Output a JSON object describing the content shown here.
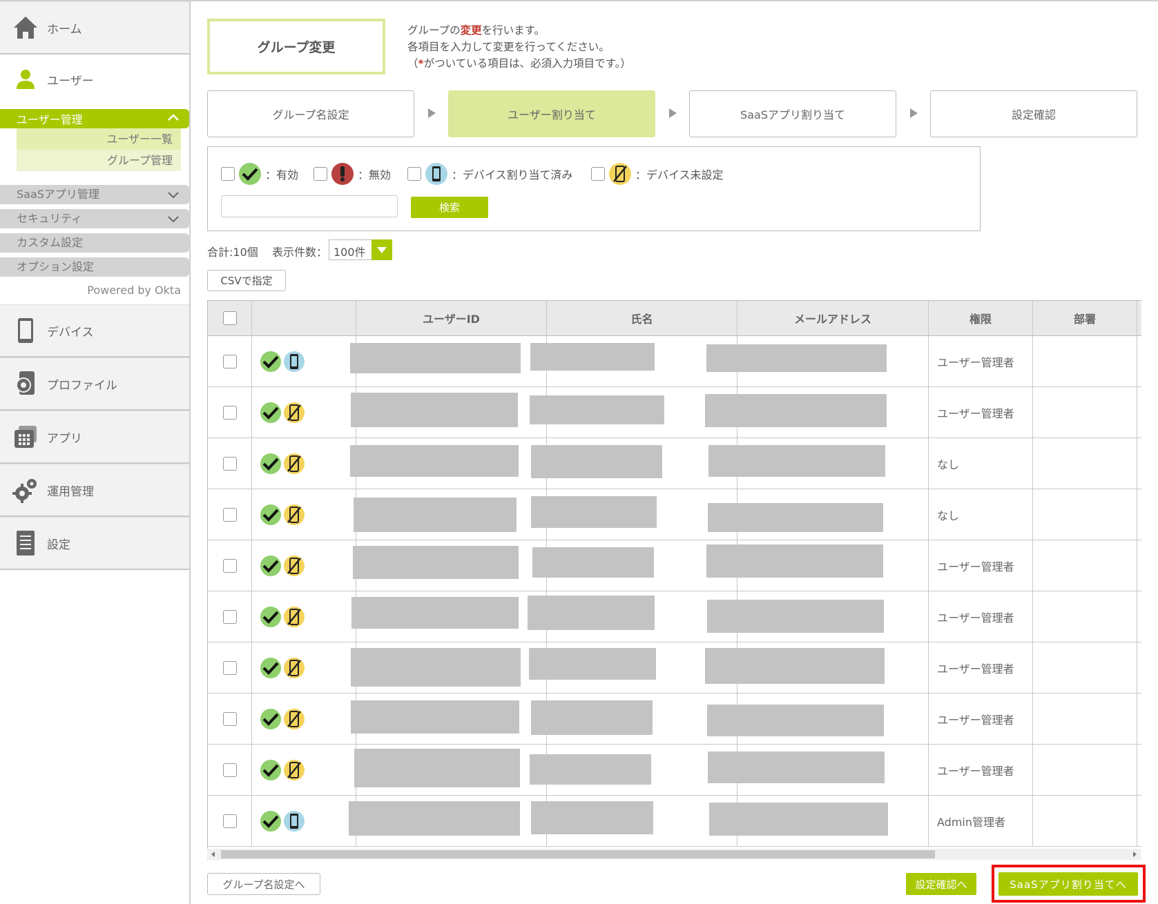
{
  "sidebar": {
    "home": "ホーム",
    "user": "ユーザー",
    "user_management": "ユーザー管理",
    "sub_user_list": "ユーザー一覧",
    "sub_group_management": "グループ管理",
    "saas_app_management": "SaaSアプリ管理",
    "security": "セキュリティ",
    "custom_settings": "カスタム設定",
    "option_settings": "オプション設定",
    "powered_by": "Powered by Okta",
    "device": "デバイス",
    "profile": "プロファイル",
    "app": "アプリ",
    "operations": "運用管理",
    "settings": "設定"
  },
  "page": {
    "title": "グループ変更",
    "desc_line1_a": "グループの",
    "desc_line1_red": "変更",
    "desc_line1_b": "を行います。",
    "desc_line2": "各項目を入力して変更を行ってください。",
    "desc_line3_a": "（",
    "desc_line3_red": "*",
    "desc_line3_b": "がついている項目は、必須入力項目です。）"
  },
  "steps": [
    {
      "label": "グループ名設定",
      "active": false
    },
    {
      "label": "ユーザー割り当て",
      "active": true
    },
    {
      "label": "SaaSアプリ割り当て",
      "active": false
    },
    {
      "label": "設定確認",
      "active": false
    }
  ],
  "filters": {
    "valid": "：有効",
    "invalid": "：無効",
    "device_assigned": "：デバイス割り当て済み",
    "device_unset": "：デバイス未設定",
    "search_button": "検索",
    "search_value": ""
  },
  "list_meta": {
    "total": "合計:10個",
    "per_page_label": "表示件数：",
    "per_page_value": "100件",
    "csv_button": "CSVで指定"
  },
  "table": {
    "headers": [
      "",
      "",
      "ユーザーID",
      "氏名",
      "メールアドレス",
      "権限",
      "部署"
    ],
    "rows": [
      {
        "device": "assigned",
        "role": "ユーザー管理者"
      },
      {
        "device": "unset",
        "role": "ユーザー管理者"
      },
      {
        "device": "unset",
        "role": "なし"
      },
      {
        "device": "unset",
        "role": "なし"
      },
      {
        "device": "unset",
        "role": "ユーザー管理者"
      },
      {
        "device": "unset",
        "role": "ユーザー管理者"
      },
      {
        "device": "unset",
        "role": "ユーザー管理者"
      },
      {
        "device": "unset",
        "role": "ユーザー管理者"
      },
      {
        "device": "unset",
        "role": "ユーザー管理者"
      },
      {
        "device": "assigned",
        "role": "Admin管理者"
      }
    ]
  },
  "footer": {
    "back_button": "グループ名設定へ",
    "confirm_button": "設定確認へ",
    "next_button": "SaaSアプリ割り当てへ"
  },
  "colors": {
    "accent": "#a8c800",
    "active_step": "#dce89a",
    "status_valid": "#8fcf6c",
    "status_invalid": "#b7413f",
    "device_assigned": "#a7d6e6",
    "device_unset": "#f3d35b",
    "highlight": "#ee1111"
  },
  "icons": {
    "home": "home-icon",
    "user": "user-icon",
    "device": "phone-icon",
    "profile": "profile-gear-icon",
    "app": "app-grid-icon",
    "operations": "gears-icon",
    "settings": "document-icon"
  }
}
